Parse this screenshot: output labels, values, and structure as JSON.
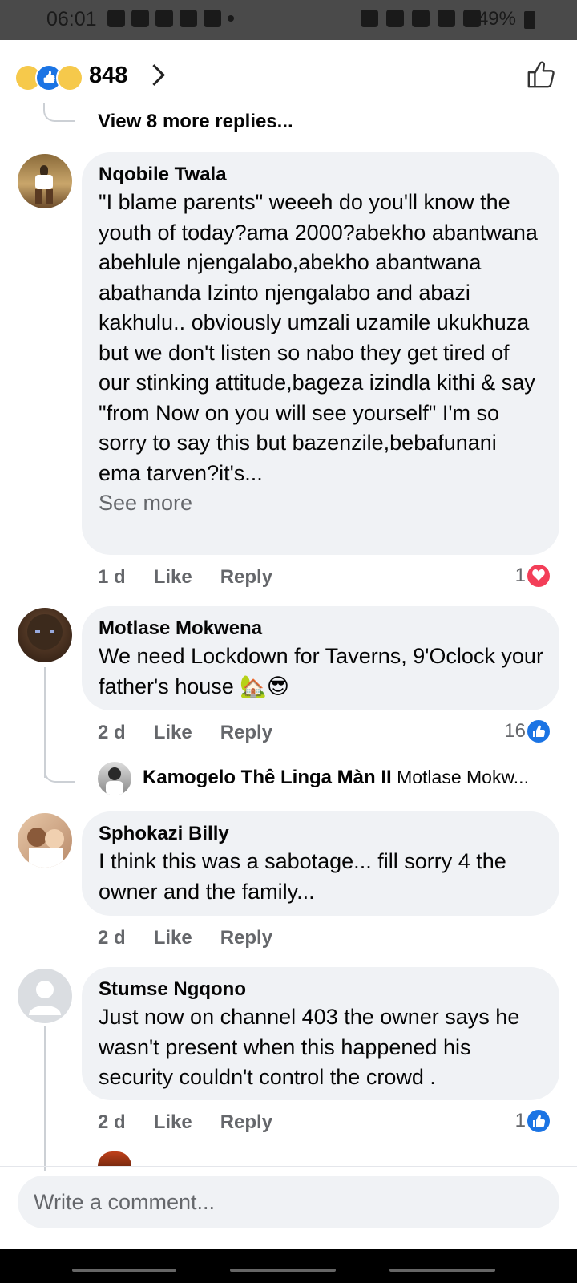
{
  "status_bar": {
    "time": "06:01",
    "battery": "49%"
  },
  "reactions": {
    "count": "848"
  },
  "view_more": "View 8 more replies...",
  "comments": [
    {
      "author": "Nqobile Twala",
      "text": "\"I blame parents\" weeeh do you'll know the youth of today?ama 2000?abekho abantwana abehlule njengalabo,abekho abantwana abathanda Izinto njengalabo and abazi kakhulu.. obviously umzali uzamile ukukhuza but we don't listen so nabo they get tired of our stinking attitude,bageza izindla kithi & say \"from Now on you will see yourself\" I'm so sorry to say this but bazenzile,bebafunani ema tarven?it's...",
      "see_more": "See more",
      "time": "1 d",
      "like": "Like",
      "reply": "Reply",
      "reaction_count": "1",
      "reaction_type": "heart"
    },
    {
      "author": "Motlase Mokwena",
      "text": "We need Lockdown for Taverns, 9'Oclock your father's house 🏡😎",
      "time": "2 d",
      "like": "Like",
      "reply": "Reply",
      "reaction_count": "16",
      "reaction_type": "like",
      "reply_preview": {
        "author": "Kamogelo Thê Linga Màn II",
        "text": "Motlase Mokw..."
      }
    },
    {
      "author": "Sphokazi Billy",
      "text": "I think this was a sabotage... fill sorry 4 the owner and the family...",
      "time": "2 d",
      "like": "Like",
      "reply": "Reply"
    },
    {
      "author": "Stumse Ngqono",
      "text": "Just now on channel 403 the owner says he wasn't present when this happened his security couldn't control the crowd .",
      "time": "2 d",
      "like": "Like",
      "reply": "Reply",
      "reaction_count": "1",
      "reaction_type": "like"
    }
  ],
  "composer": {
    "placeholder": "Write a comment..."
  },
  "colors": {
    "bubble": "#f0f2f5",
    "like_blue": "#1b74e4",
    "heart_red": "#f33e58",
    "meta_gray": "#65676b"
  }
}
